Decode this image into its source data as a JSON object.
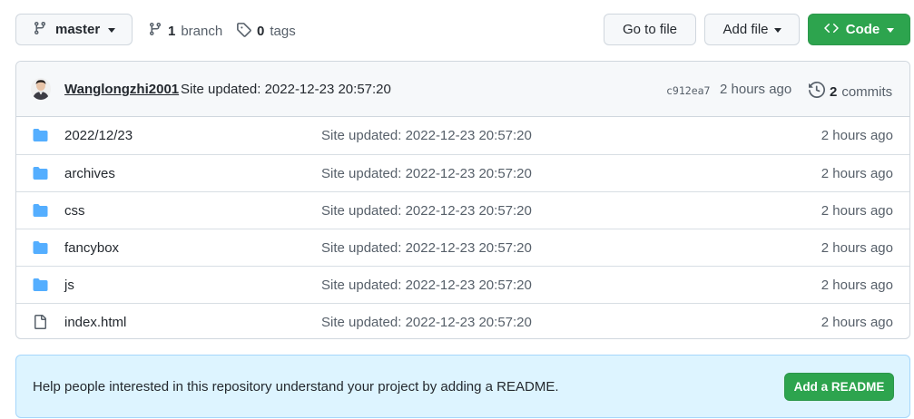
{
  "toolbar": {
    "branch_button_label": "master",
    "branch_count": "1",
    "branch_word": "branch",
    "tag_count": "0",
    "tag_word": "tags",
    "go_to_file_label": "Go to file",
    "add_file_label": "Add file",
    "code_label": "Code"
  },
  "latest_commit": {
    "author": "Wanglongzhi2001",
    "message": "Site updated: 2022-12-23 20:57:20",
    "sha": "c912ea7",
    "time": "2 hours ago",
    "commits_count": "2",
    "commits_word": "commits"
  },
  "files": [
    {
      "type": "folder",
      "icon": "folder-icon",
      "name": "2022/12/23",
      "message": "Site updated: 2022-12-23 20:57:20",
      "time": "2 hours ago"
    },
    {
      "type": "folder",
      "icon": "folder-icon",
      "name": "archives",
      "message": "Site updated: 2022-12-23 20:57:20",
      "time": "2 hours ago"
    },
    {
      "type": "folder",
      "icon": "folder-icon",
      "name": "css",
      "message": "Site updated: 2022-12-23 20:57:20",
      "time": "2 hours ago"
    },
    {
      "type": "folder",
      "icon": "folder-icon",
      "name": "fancybox",
      "message": "Site updated: 2022-12-23 20:57:20",
      "time": "2 hours ago"
    },
    {
      "type": "folder",
      "icon": "folder-icon",
      "name": "js",
      "message": "Site updated: 2022-12-23 20:57:20",
      "time": "2 hours ago"
    },
    {
      "type": "file",
      "icon": "file-icon",
      "name": "index.html",
      "message": "Site updated: 2022-12-23 20:57:20",
      "time": "2 hours ago"
    }
  ],
  "readme_banner": {
    "text": "Help people interested in this repository understand your project by adding a README.",
    "button_label": "Add a README"
  },
  "colors": {
    "primary_green": "#2da44e",
    "folder_blue": "#54aeff",
    "banner_blue": "#ddf4ff"
  }
}
